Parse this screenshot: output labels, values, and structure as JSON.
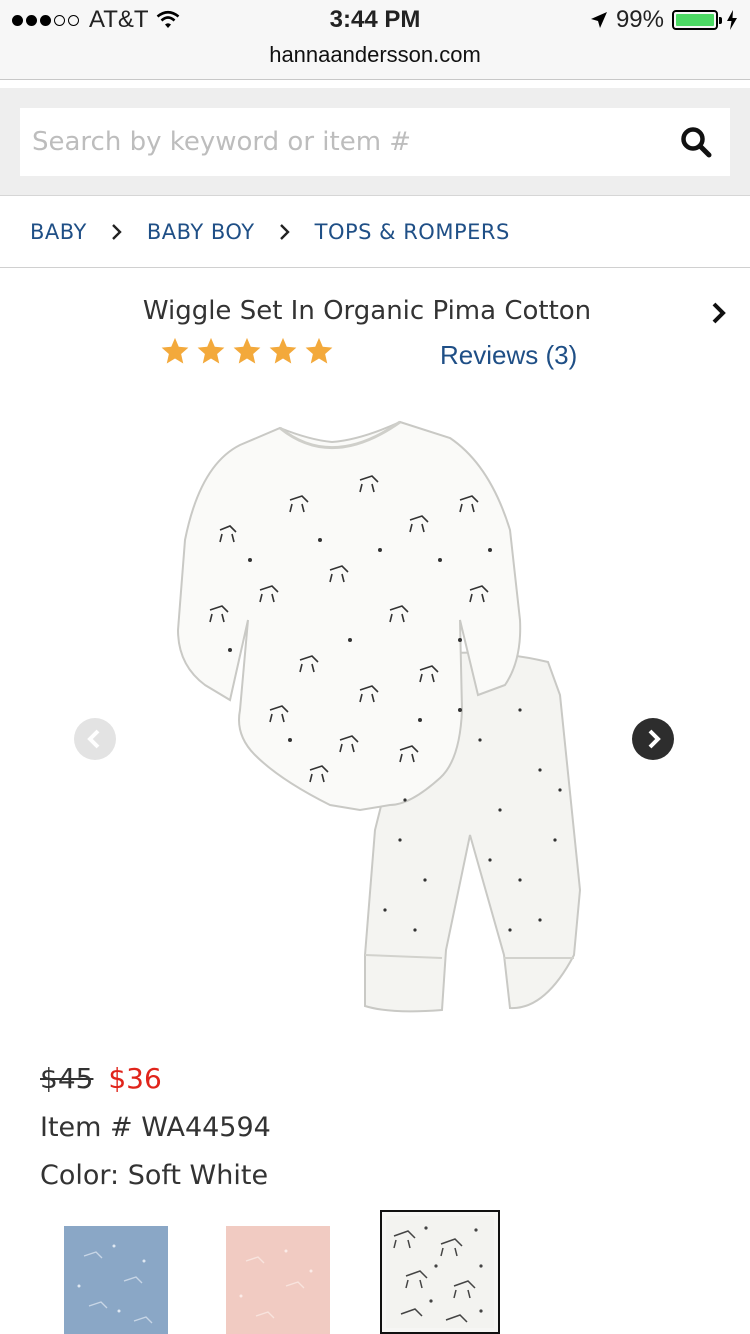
{
  "status": {
    "carrier": "AT&T",
    "time": "3:44 PM",
    "battery": "99%",
    "battery_level": 0.99
  },
  "browser": {
    "url": "hannaandersson.com"
  },
  "search": {
    "placeholder": "Search by keyword or item #",
    "value": ""
  },
  "breadcrumb": [
    "BABY",
    "BABY BOY",
    "TOPS & ROMPERS"
  ],
  "product": {
    "title": "Wiggle Set In Organic Pima Cotton",
    "rating": 5,
    "rating_max": 5,
    "reviews_label": "Reviews (3)",
    "old_price": "$45",
    "new_price": "$36",
    "item_label": "Item # WA44594",
    "color_label": "Color: Soft White"
  },
  "colors": {
    "accent": "#1f4f86",
    "sale": "#e0241b",
    "star": "#f3a93b"
  },
  "swatches": [
    {
      "name": "blue",
      "color": "#8aa7c6",
      "selected": false
    },
    {
      "name": "pink",
      "color": "#f1cbc2",
      "selected": false
    },
    {
      "name": "soft-white",
      "color": "#f6f6f4",
      "selected": true
    }
  ]
}
